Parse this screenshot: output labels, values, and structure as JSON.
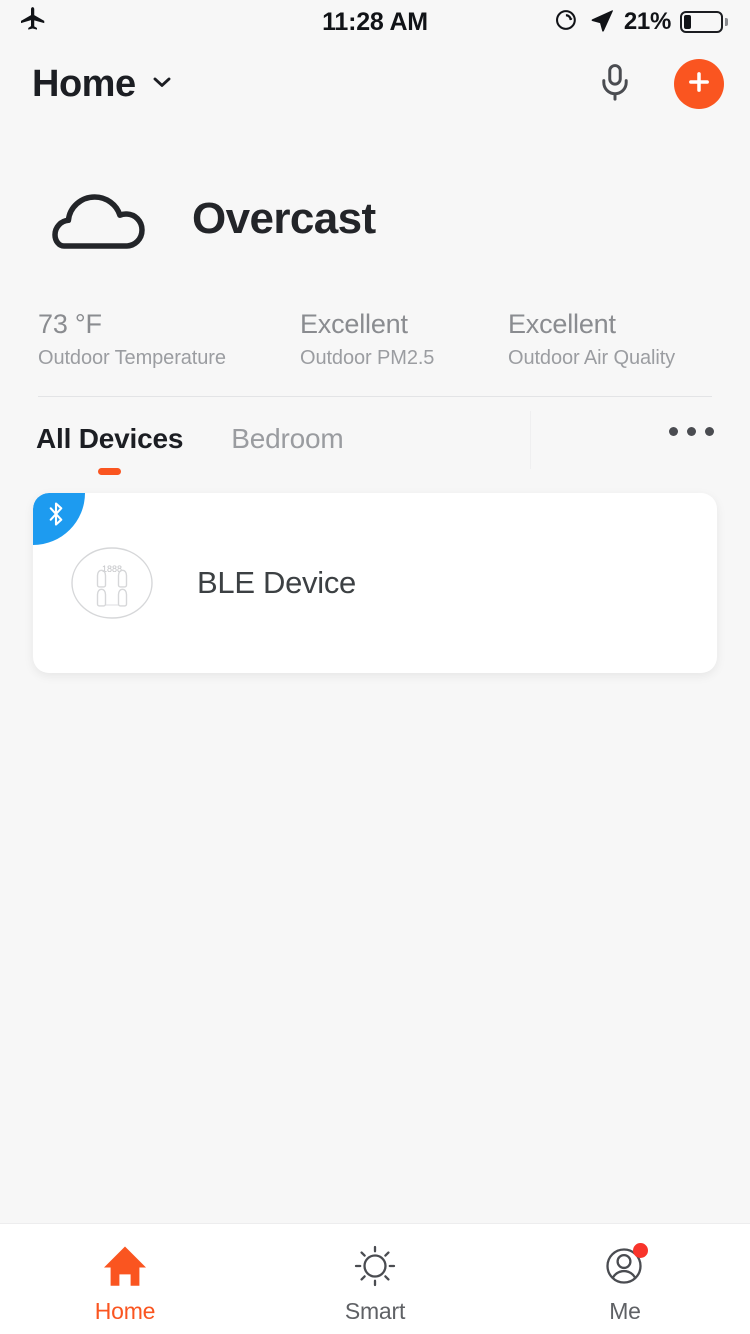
{
  "status_bar": {
    "airplane_icon": "airplane-mode-icon",
    "time": "11:28 AM",
    "rotation_lock_icon": "rotation-lock-icon",
    "location_icon": "location-arrow-icon",
    "battery_percent": "21%",
    "battery_level": 21
  },
  "header": {
    "home_label": "Home",
    "chevron_icon": "chevron-down-icon",
    "mic_icon": "microphone-icon",
    "add_icon": "plus-icon"
  },
  "weather": {
    "condition_icon": "cloud-icon",
    "condition": "Overcast",
    "stats": [
      {
        "value": "73 °F",
        "label": "Outdoor Temperature"
      },
      {
        "value": "Excellent",
        "label": "Outdoor PM2.5"
      },
      {
        "value": "Excellent",
        "label": "Outdoor Air Quality"
      }
    ]
  },
  "tabs": {
    "items": [
      {
        "label": "All Devices",
        "active": true
      },
      {
        "label": "Bedroom",
        "active": false
      }
    ],
    "more_label": "more-options"
  },
  "devices": [
    {
      "name": "BLE Device",
      "badge": "bluetooth-icon",
      "icon": "body-scale-icon",
      "display_value": "1888"
    }
  ],
  "bottom_nav": [
    {
      "label": "Home",
      "icon": "home-icon",
      "active": true,
      "badge": false
    },
    {
      "label": "Smart",
      "icon": "sun-brightness-icon",
      "active": false,
      "badge": false
    },
    {
      "label": "Me",
      "icon": "person-avatar-icon",
      "active": false,
      "badge": true
    }
  ],
  "colors": {
    "accent": "#FA5520",
    "bluetooth": "#1D9BF0",
    "badge_red": "#F8342B",
    "background": "#F7F7F7",
    "card": "#FFFFFF"
  }
}
